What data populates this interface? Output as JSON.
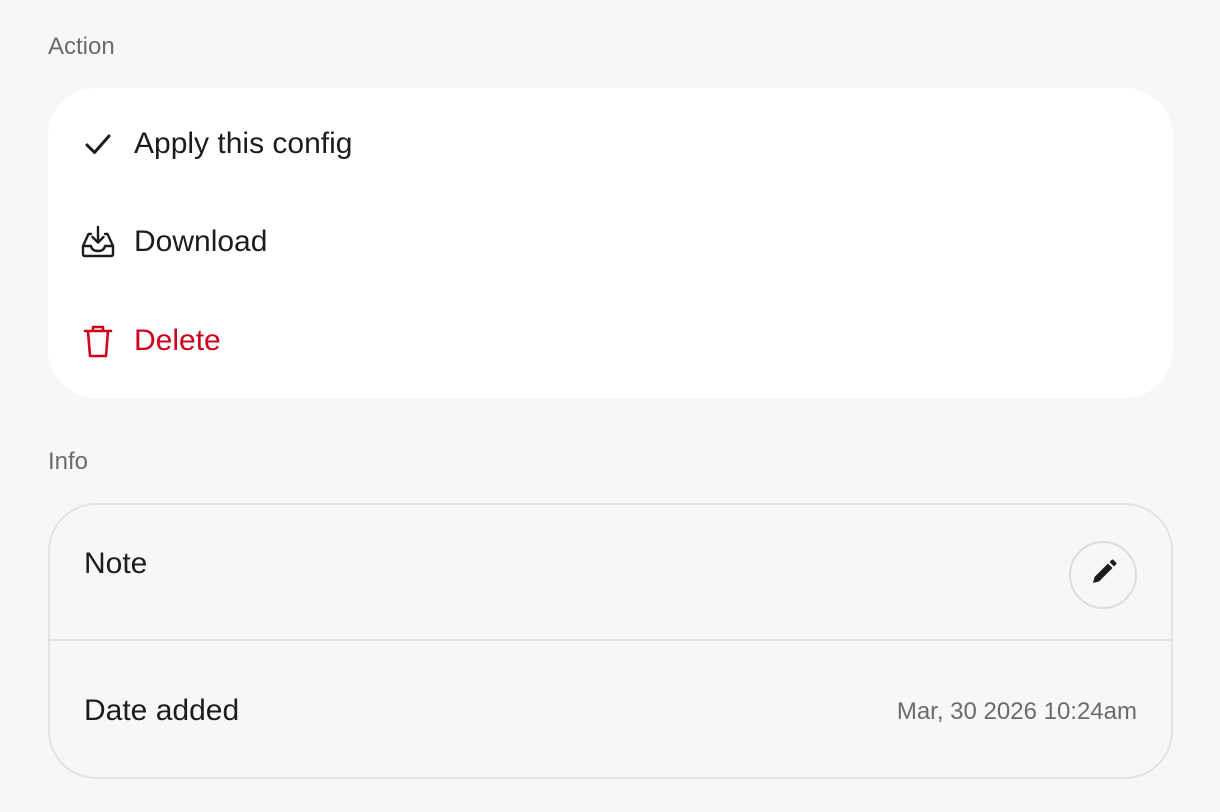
{
  "sections": {
    "action_label": "Action",
    "info_label": "Info"
  },
  "actions": {
    "apply": {
      "label": "Apply this config",
      "icon": "check-icon"
    },
    "download": {
      "label": "Download",
      "icon": "download-tray-icon"
    },
    "delete": {
      "label": "Delete",
      "icon": "trash-icon",
      "color": "#d0021b"
    }
  },
  "info": {
    "note": {
      "title": "Note",
      "edit_icon": "pencil-icon"
    },
    "date_added": {
      "title": "Date added",
      "value": "Mar, 30 2026 10:24am"
    }
  },
  "colors": {
    "background": "#f7f7f7",
    "card": "#ffffff",
    "danger": "#d0021b",
    "muted_text": "#6b6b6b"
  }
}
